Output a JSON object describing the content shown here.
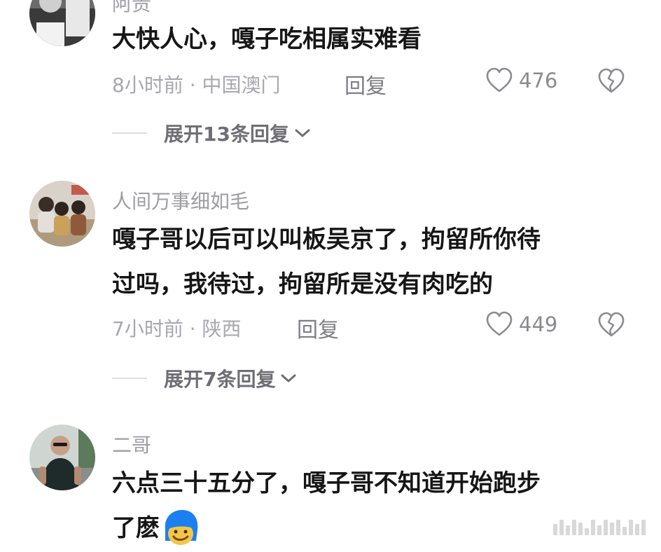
{
  "comments": [
    {
      "username": "阿贵",
      "text": [
        "大快人心，嘎子吃相属实难看"
      ],
      "meta": "8小时前 · 中国澳门",
      "reply_label": "回复",
      "likes": "476",
      "expand_label": "展开13条回复"
    },
    {
      "username": "人间万事细如毛",
      "text": [
        "嘎子哥以后可以叫板吴京了，拘留所你待",
        "过吗，我待过，拘留所是没有肉吃的"
      ],
      "meta": "7小时前 · 陕西",
      "reply_label": "回复",
      "likes": "449",
      "expand_label": "展开7条回复"
    },
    {
      "username": "二哥",
      "text": [
        "六点三十五分了，嘎子哥不知道开始跑步",
        "了麽"
      ],
      "emoji": "blue-hair-face-emoji"
    }
  ],
  "icons": {
    "like": "heart-outline-icon",
    "dislike": "broken-heart-icon",
    "expand": "chevron-down-icon"
  },
  "colors": {
    "text": "#161616",
    "muted": "#a7a7ad",
    "icon": "#8a8a90",
    "emoji_hair": "#1b7ff0"
  }
}
